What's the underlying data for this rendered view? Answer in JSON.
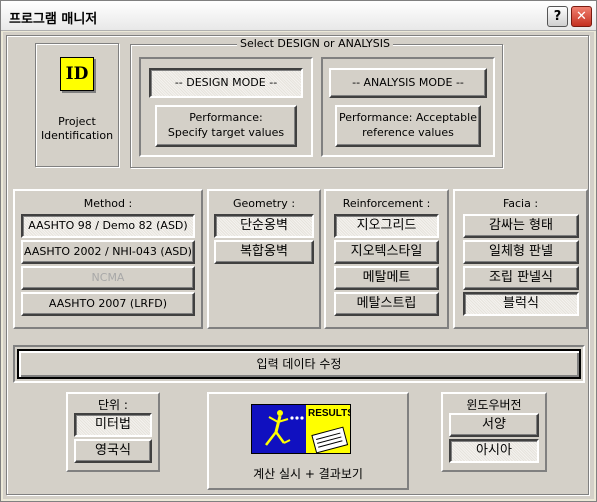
{
  "window": {
    "title": "프로그램 매니저",
    "help_button": "?",
    "close_button": "✕"
  },
  "project": {
    "icon_text": "ID",
    "label": "Project\nIdentification"
  },
  "mode_section": {
    "legend": "Select  DESIGN  or  ANALYSIS",
    "design_mode": "-- DESIGN MODE --",
    "design_performance": "Performance:\nSpecify target values",
    "analysis_mode": "-- ANALYSIS MODE --",
    "analysis_performance": "Performance: Acceptable\nreference values"
  },
  "method": {
    "title": "Method :",
    "options": [
      "AASHTO 98 / Demo 82 (ASD)",
      "AASHTO 2002 / NHI-043 (ASD)",
      "NCMA",
      "AASHTO 2007 (LRFD)"
    ]
  },
  "geometry": {
    "title": "Geometry :",
    "options": [
      "단순옹벽",
      "복합옹벽"
    ]
  },
  "reinforcement": {
    "title": "Reinforcement :",
    "options": [
      "지오그리드",
      "지오텍스타일",
      "메탈메트",
      "메탈스트립"
    ]
  },
  "facia": {
    "title": "Facia :",
    "options": [
      "감싸는 형태",
      "일체형 판넬",
      "조립 판넬식",
      "블럭식"
    ]
  },
  "edit_input": "입력 데이타 수정",
  "units": {
    "title": "단위 :",
    "options": [
      "미터법",
      "영국식"
    ]
  },
  "calc": {
    "results_text": "RESULTS",
    "label": "계산 실시 + 결과보기"
  },
  "windows_version": {
    "title": "윈도우버전",
    "options": [
      "서양",
      "아시아"
    ]
  },
  "colors": {
    "face": "#d4d0c8",
    "icon_yellow": "#ffff00",
    "results_blue": "#1010c0"
  }
}
